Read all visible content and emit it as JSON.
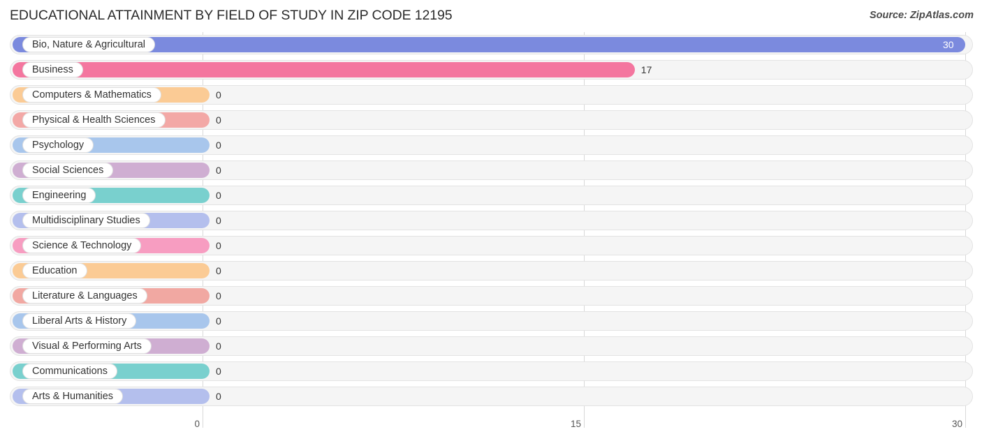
{
  "header": {
    "title": "EDUCATIONAL ATTAINMENT BY FIELD OF STUDY IN ZIP CODE 12195",
    "source": "Source: ZipAtlas.com"
  },
  "chart_data": {
    "type": "bar",
    "orientation": "horizontal",
    "title": "EDUCATIONAL ATTAINMENT BY FIELD OF STUDY IN ZIP CODE 12195",
    "subtitle": "",
    "xlabel": "",
    "ylabel": "",
    "xlim": [
      0,
      30
    ],
    "xticks": [
      0,
      15,
      30
    ],
    "xtick_labels": [
      "0",
      "15",
      "30"
    ],
    "grid": true,
    "legend": false,
    "categories": [
      "Bio, Nature & Agricultural",
      "Business",
      "Computers & Mathematics",
      "Physical & Health Sciences",
      "Psychology",
      "Social Sciences",
      "Engineering",
      "Multidisciplinary Studies",
      "Science & Technology",
      "Education",
      "Literature & Languages",
      "Liberal Arts & History",
      "Visual & Performing Arts",
      "Communications",
      "Arts & Humanities"
    ],
    "values": [
      30,
      17,
      0,
      0,
      0,
      0,
      0,
      0,
      0,
      0,
      0,
      0,
      0,
      0,
      0
    ],
    "value_labels": [
      "30",
      "17",
      "0",
      "0",
      "0",
      "0",
      "0",
      "0",
      "0",
      "0",
      "0",
      "0",
      "0",
      "0",
      "0"
    ],
    "bar_colors": [
      "#7b8ade",
      "#f4769f",
      "#fbcb95",
      "#f3a8a6",
      "#a8c6ec",
      "#cfaed2",
      "#79d0ce",
      "#b4bfed",
      "#f79dc1",
      "#fbcb95",
      "#f1a8a2",
      "#a8c6ec",
      "#cfaed2",
      "#79d0ce",
      "#b4bfed"
    ]
  },
  "rows": [
    {
      "label": "Bio, Nature & Agricultural",
      "value": 30,
      "value_label": "30",
      "color": "#7b8ade"
    },
    {
      "label": "Business",
      "value": 17,
      "value_label": "17",
      "color": "#f4769f"
    },
    {
      "label": "Computers & Mathematics",
      "value": 0,
      "value_label": "0",
      "color": "#fbcb95"
    },
    {
      "label": "Physical & Health Sciences",
      "value": 0,
      "value_label": "0",
      "color": "#f3a8a6"
    },
    {
      "label": "Psychology",
      "value": 0,
      "value_label": "0",
      "color": "#a8c6ec"
    },
    {
      "label": "Social Sciences",
      "value": 0,
      "value_label": "0",
      "color": "#cfaed2"
    },
    {
      "label": "Engineering",
      "value": 0,
      "value_label": "0",
      "color": "#79d0ce"
    },
    {
      "label": "Multidisciplinary Studies",
      "value": 0,
      "value_label": "0",
      "color": "#b4bfed"
    },
    {
      "label": "Science & Technology",
      "value": 0,
      "value_label": "0",
      "color": "#f79dc1"
    },
    {
      "label": "Education",
      "value": 0,
      "value_label": "0",
      "color": "#fbcb95"
    },
    {
      "label": "Literature & Languages",
      "value": 0,
      "value_label": "0",
      "color": "#f1a8a2"
    },
    {
      "label": "Liberal Arts & History",
      "value": 0,
      "value_label": "0",
      "color": "#a8c6ec"
    },
    {
      "label": "Visual & Performing Arts",
      "value": 0,
      "value_label": "0",
      "color": "#cfaed2"
    },
    {
      "label": "Communications",
      "value": 0,
      "value_label": "0",
      "color": "#79d0ce"
    },
    {
      "label": "Arts & Humanities",
      "value": 0,
      "value_label": "0",
      "color": "#b4bfed"
    }
  ],
  "axis": {
    "ticks": [
      {
        "label": "0",
        "value": 0
      },
      {
        "label": "15",
        "value": 15
      },
      {
        "label": "30",
        "value": 30
      }
    ]
  }
}
